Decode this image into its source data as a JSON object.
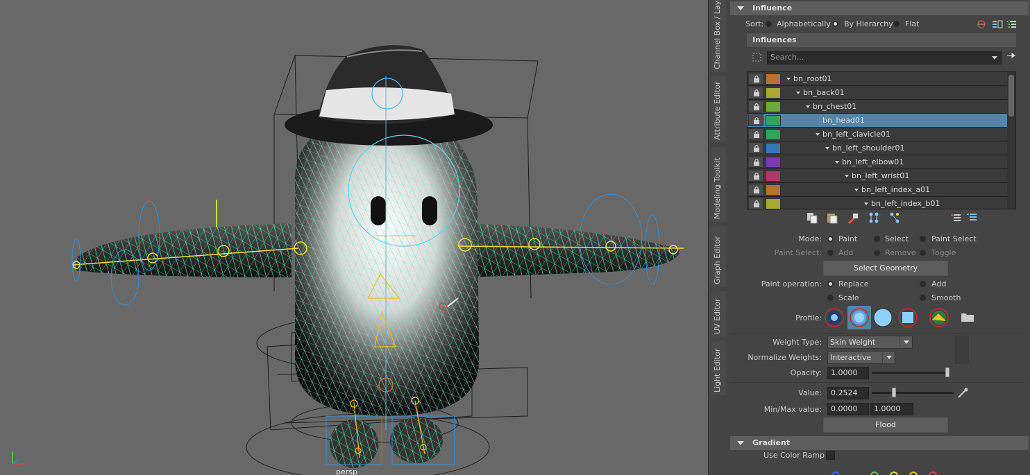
{
  "viewport": {
    "camera_label": "persp"
  },
  "side_tabs": [
    "Channel Box / Layer Editor",
    "Attribute Editor",
    "Modeling Toolkit",
    "Graph Editor",
    "UV Editor",
    "Light Editor"
  ],
  "influence": {
    "header": "Influence",
    "sort_label": "Sort:",
    "sort_options": [
      "Alphabetically",
      "By Hierarchy",
      "Flat"
    ],
    "sort_selected": "By Hierarchy",
    "influences_header": "Influences",
    "search_placeholder": "Search...",
    "tree": [
      {
        "name": "bn_root01",
        "color": "#b5742d",
        "depth": 0,
        "selected": false
      },
      {
        "name": "bn_back01",
        "color": "#a8a833",
        "depth": 1,
        "selected": false
      },
      {
        "name": "bn_chest01",
        "color": "#6da93a",
        "depth": 2,
        "selected": false
      },
      {
        "name": "bn_head01",
        "color": "#2ea55a",
        "depth": 3,
        "selected": true
      },
      {
        "name": "bn_left_clavicle01",
        "color": "#2ea55a",
        "depth": 3,
        "selected": false
      },
      {
        "name": "bn_left_shoulder01",
        "color": "#3a78b5",
        "depth": 4,
        "selected": false
      },
      {
        "name": "bn_left_elbow01",
        "color": "#7a3ab5",
        "depth": 5,
        "selected": false
      },
      {
        "name": "bn_left_wrist01",
        "color": "#b5366a",
        "depth": 6,
        "selected": false
      },
      {
        "name": "bn_left_index_a01",
        "color": "#b5742d",
        "depth": 7,
        "selected": false
      },
      {
        "name": "bn_left_index_b01",
        "color": "#a8a833",
        "depth": 8,
        "selected": false
      }
    ]
  },
  "paint": {
    "mode_label": "Mode:",
    "mode_options": [
      "Paint",
      "Select",
      "Paint Select"
    ],
    "mode_selected": "Paint",
    "paint_select_label": "Paint Select:",
    "paint_select_options": [
      "Add",
      "Remove",
      "Toggle"
    ],
    "select_geometry": "Select Geometry",
    "operation_label": "Paint operation:",
    "operation_options": [
      "Replace",
      "Add",
      "Scale",
      "Smooth"
    ],
    "operation_selected": "Replace",
    "profile_label": "Profile:",
    "weight_type_label": "Weight Type:",
    "weight_type": "Skin Weight",
    "normalize_label": "Normalize Weights:",
    "normalize": "Interactive",
    "opacity_label": "Opacity:",
    "opacity": "1.0000",
    "opacity_value": 1.0,
    "value_label": "Value:",
    "value": "0.2524",
    "value_value": 0.2524,
    "minmax_label": "Min/Max value:",
    "min": "0.0000",
    "max": "1.0000",
    "flood": "Flood"
  },
  "gradient": {
    "header": "Gradient",
    "use_color_ramp": "Use Color Ramp"
  }
}
